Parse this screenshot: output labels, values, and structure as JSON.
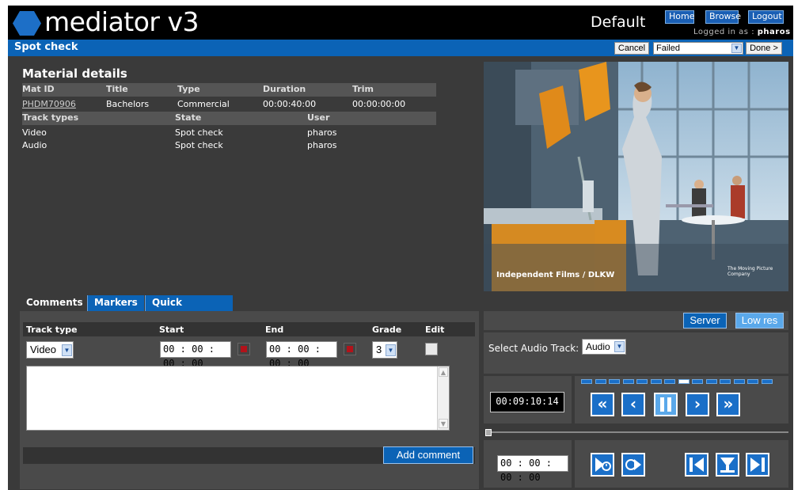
{
  "header": {
    "app_name": "mediator v3",
    "profile": "Default",
    "links": {
      "home": "Home",
      "browse": "Browse",
      "logout": "Logout"
    },
    "logged_in_prefix": "Logged in as :",
    "user": "pharos"
  },
  "titlebar": {
    "title": "Spot check",
    "cancel_label": "Cancel",
    "status_value": "Failed",
    "done_label": "Done >"
  },
  "material": {
    "section_title": "Material details",
    "columns": [
      "Mat ID",
      "Title",
      "Type",
      "Duration",
      "Trim"
    ],
    "row": {
      "mat_id": "PHDM70906",
      "title": "Bachelors",
      "type": "Commercial",
      "duration": "00:00:40:00",
      "trim": "00:00:00:00"
    },
    "track_columns": [
      "Track types",
      "State",
      "User"
    ],
    "tracks": [
      {
        "type": "Video",
        "state": "Spot check",
        "user": "pharos"
      },
      {
        "type": "Audio",
        "state": "Spot check",
        "user": "pharos"
      }
    ]
  },
  "video": {
    "caption": "Independent Films / DLKW",
    "caption_small": "The Moving Picture Company"
  },
  "tabs": [
    "Comments",
    "Markers",
    "Quick Markers"
  ],
  "comments": {
    "columns": {
      "track_type": "Track type",
      "start": "Start",
      "end": "End",
      "grade": "Grade",
      "edit": "Edit"
    },
    "track_type_value": "Video",
    "start_value": "00 : 00 : 00 : 00",
    "end_value": "00 : 00 : 00 : 00",
    "grade_value": "3",
    "add_label": "Add comment"
  },
  "player": {
    "server_label": "Server",
    "lowres_label": "Low res",
    "audio_track_label": "Select Audio Track:",
    "audio_track_value": "Audio",
    "timecode": "00:09:10:14",
    "mark_timecode": "00 : 00 : 00 : 00",
    "speed_segments": 14,
    "active_speed_segment": 7,
    "position_fraction": 0.0
  },
  "colors": {
    "accent": "#0b63b6",
    "panel": "#4a4a4a",
    "background": "#3a3a3a"
  },
  "icons": [
    "rewind-fast-icon",
    "step-back-icon",
    "pause-icon",
    "step-forward-icon",
    "forward-fast-icon",
    "play-to-mark-icon",
    "go-to-mark-icon",
    "go-start-icon",
    "set-mark-icon",
    "go-end-icon"
  ]
}
